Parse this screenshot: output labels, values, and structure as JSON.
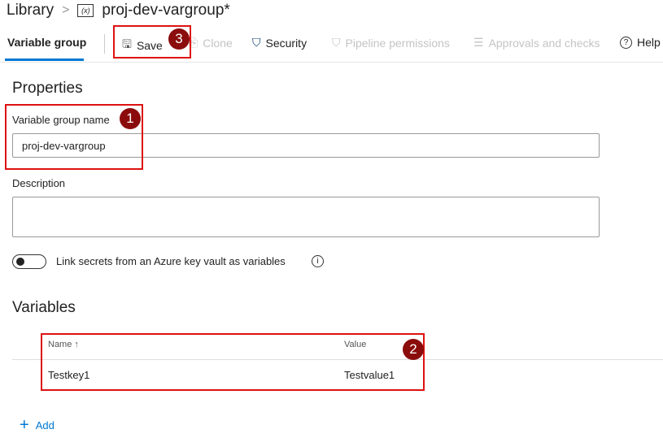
{
  "breadcrumb": {
    "root": "Library",
    "current": "proj-dev-vargroup*"
  },
  "toolbar": {
    "tab": "Variable group",
    "save": "Save",
    "clone": "Clone",
    "security": "Security",
    "pipeline_permissions": "Pipeline permissions",
    "approvals": "Approvals and checks",
    "help": "Help"
  },
  "properties": {
    "title": "Properties",
    "name_label": "Variable group name",
    "name_value": "proj-dev-vargroup",
    "description_label": "Description",
    "description_value": "",
    "link_secrets_label": "Link secrets from an Azure key vault as variables",
    "link_secrets_on": false
  },
  "variables": {
    "title": "Variables",
    "columns": [
      "Name ↑",
      "Value"
    ],
    "rows": [
      {
        "name": "Testkey1",
        "value": "Testvalue1"
      }
    ],
    "add": "Add"
  },
  "annotations": [
    "1",
    "2",
    "3"
  ],
  "colors": {
    "accent": "#0078d4",
    "highlight": "#dd1111",
    "badge": "#8b0c0c"
  }
}
